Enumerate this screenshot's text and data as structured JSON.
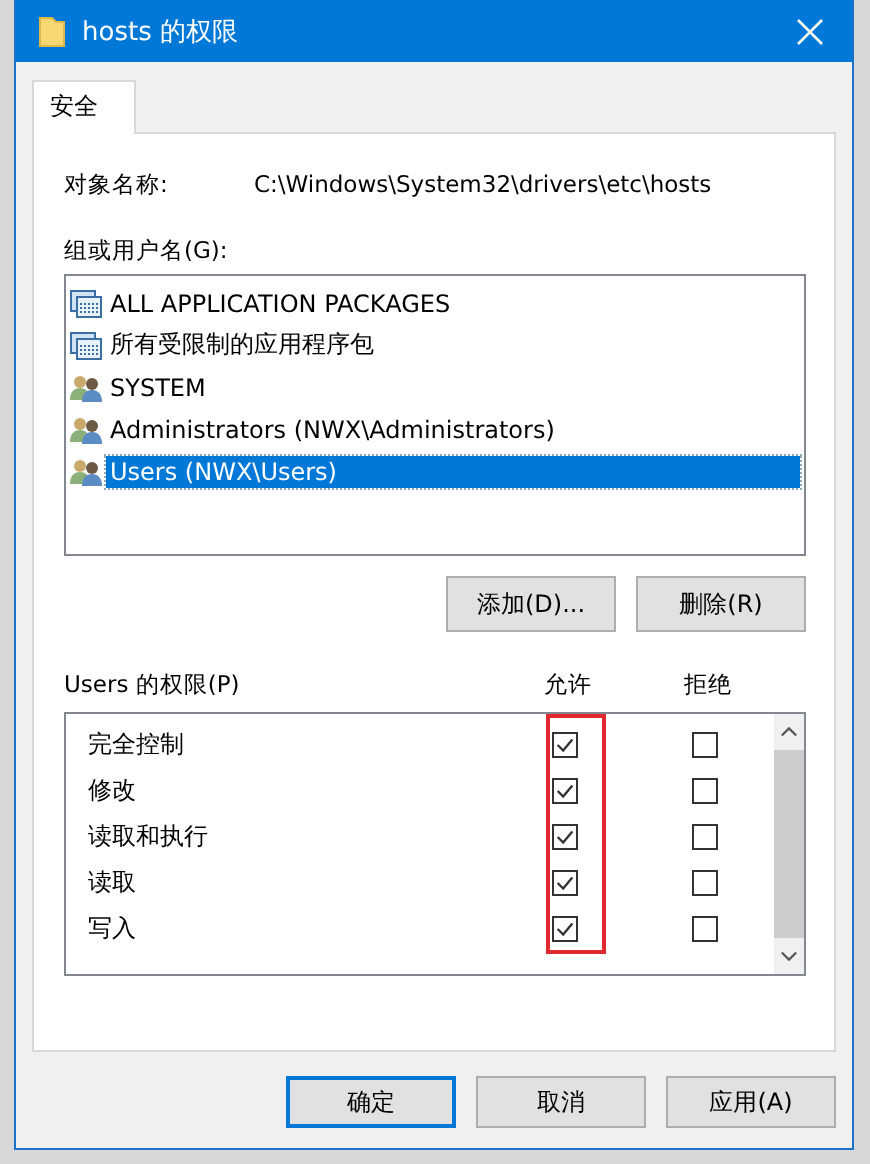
{
  "window": {
    "title": "hosts 的权限"
  },
  "tabs": [
    {
      "label": "安全",
      "selected": true
    }
  ],
  "object_name": {
    "label": "对象名称:",
    "value": "C:\\Windows\\System32\\drivers\\etc\\hosts"
  },
  "groups": {
    "label": "组或用户名(G):",
    "items": [
      {
        "name": "ALL APPLICATION PACKAGES",
        "kind": "package",
        "selected": false
      },
      {
        "name": "所有受限制的应用程序包",
        "kind": "package",
        "selected": false
      },
      {
        "name": "SYSTEM",
        "kind": "users",
        "selected": false
      },
      {
        "name": "Administrators (NWX\\Administrators)",
        "kind": "users",
        "selected": false
      },
      {
        "name": "Users (NWX\\Users)",
        "kind": "users",
        "selected": true
      }
    ]
  },
  "group_buttons": [
    "添加(D)...",
    "删除(R)"
  ],
  "permissions": {
    "label": "Users 的权限(P)",
    "allow_header": "允许",
    "deny_header": "拒绝",
    "rows": [
      {
        "name": "完全控制",
        "allow": true,
        "deny": false
      },
      {
        "name": "修改",
        "allow": true,
        "deny": false
      },
      {
        "name": "读取和执行",
        "allow": true,
        "deny": false
      },
      {
        "name": "读取",
        "allow": true,
        "deny": false
      },
      {
        "name": "写入",
        "allow": true,
        "deny": false
      }
    ]
  },
  "buttons": [
    {
      "label": "确定",
      "default": true
    },
    {
      "label": "取消",
      "default": false
    },
    {
      "label": "应用(A)",
      "default": false
    }
  ]
}
